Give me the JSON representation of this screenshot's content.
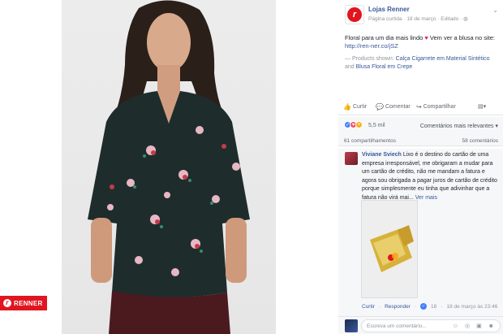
{
  "brand_badge": {
    "label": "RENNER"
  },
  "post": {
    "page_name": "Lojas Renner",
    "meta_text": "Página curtida · 18 de março · Editado · ",
    "text_main": "Floral para um dia mais lindo",
    "text_after_heart": " Vem ver a blusa no site: ",
    "link_url": "http://ren-ner.co/jSZ",
    "products_prefix": "— Products shown: ",
    "product_1": "Calça Cigarrete em Material Sintético",
    "products_joiner": " and ",
    "product_2": "Blusa Floral em Crepe"
  },
  "actions": {
    "like": "Curtir",
    "comment": "Comentar",
    "share": "Compartilhar"
  },
  "reactions": {
    "count": "5,5 mil",
    "sort_label": "Comentários mais relevantes",
    "shares": "61 compartilhamentos",
    "comments": "58 comentários"
  },
  "comment": {
    "author": "Viviane Sviech",
    "text": " Lixo é o destino do cartão de uma empresa irresponsável, me obrigaram a mudar para um cartão de crédito, não me mandam a fatura e agora sou obrigada a pagar juros de cartão de crédito porque simplesmente eu tinha que adivinhar que a fatura não virá mai... ",
    "see_more": "Ver mais",
    "like_label": "Curtir",
    "reply_label": "Responder",
    "like_count": "18",
    "timestamp": "18 de março às 23:46"
  },
  "write_comment": {
    "placeholder": "Escreva um comentário..."
  },
  "icons": {
    "heart": "♥",
    "chevron": "⌄",
    "like": "👍",
    "comment": "💬",
    "share": "↪",
    "input_icons": "☺ ◎ ▣ ☻"
  },
  "colors": {
    "brand_red": "#e1151f",
    "link_blue": "#365899",
    "meta_gray": "#90949c"
  }
}
